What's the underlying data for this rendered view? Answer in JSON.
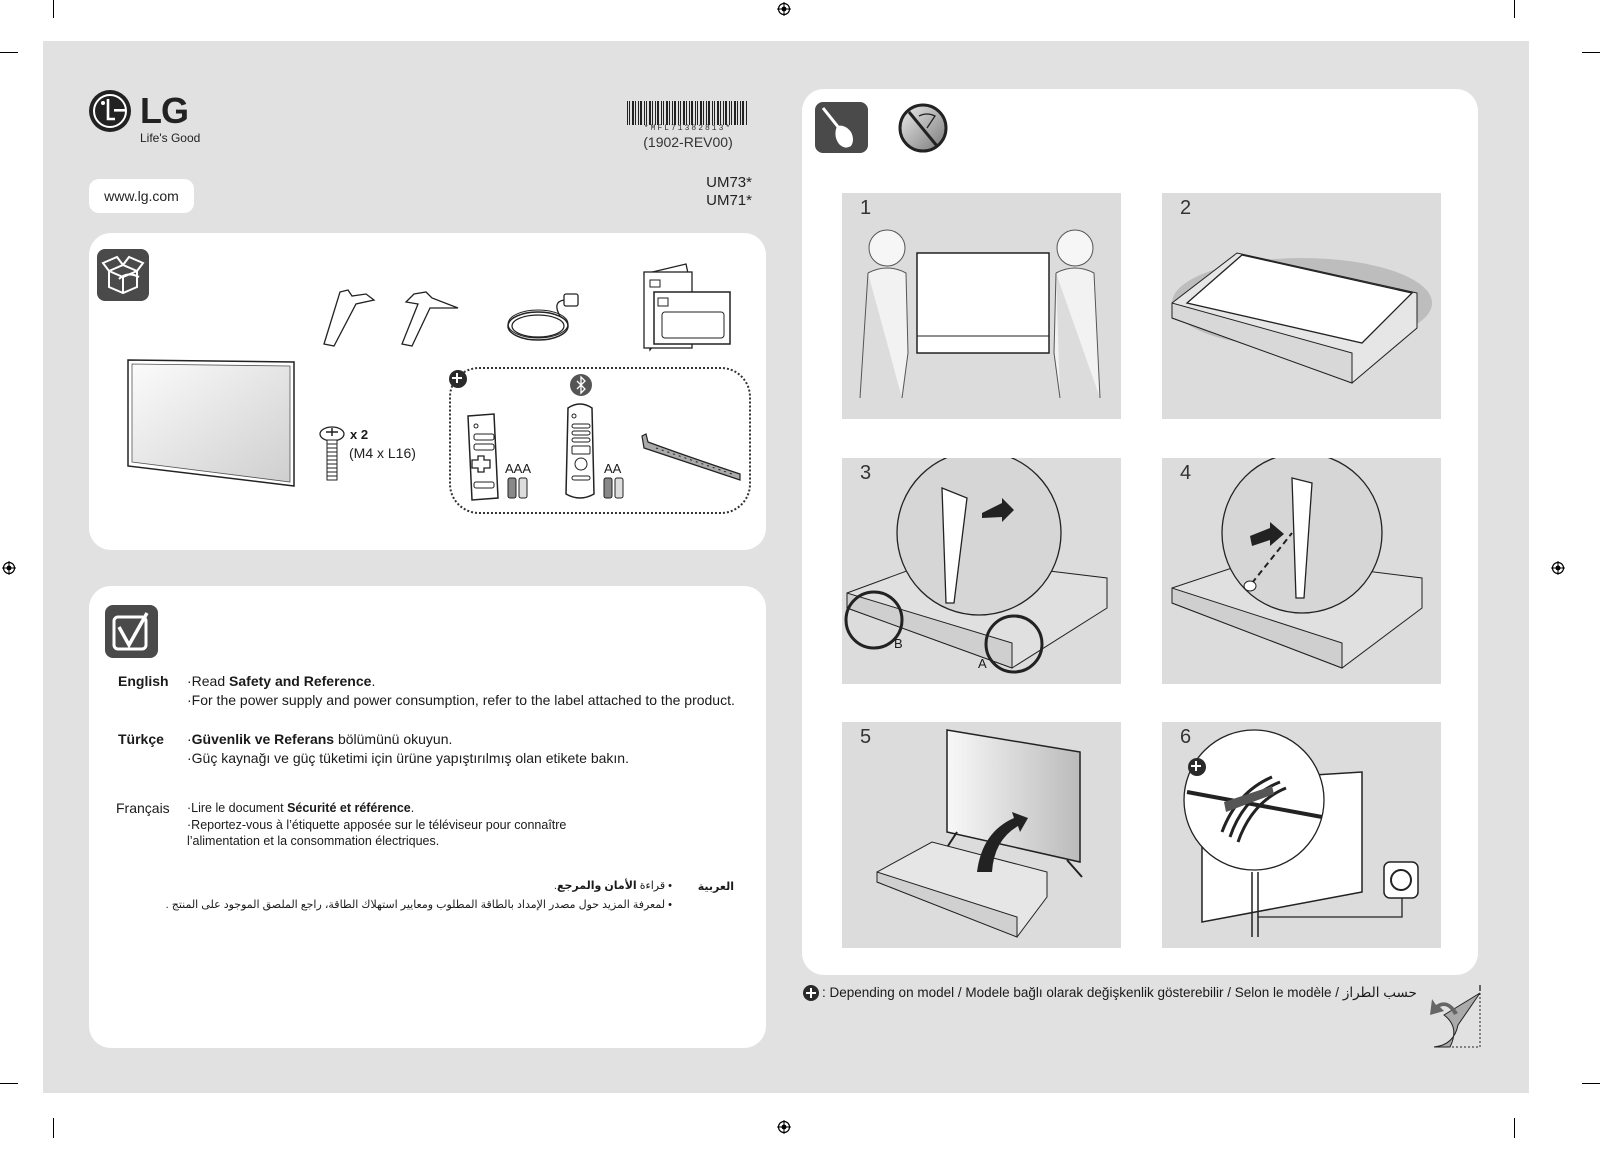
{
  "header": {
    "brand": "LG",
    "tagline": "Life's Good",
    "website": "www.lg.com",
    "barcode_text": "*MFL71382813*",
    "revision": "(1902-REV00)",
    "models": [
      "UM73*",
      "UM71*"
    ]
  },
  "box_contents": {
    "icon": "open-box-icon",
    "items": [
      "tv-panel",
      "stand-legs",
      "power-cord",
      "manuals"
    ],
    "screw_qty": "x 2",
    "screw_spec": "(M4 x L16)",
    "optional_badge_icon": "plus-circle-icon",
    "bluetooth_icon": "bluetooth-icon",
    "battery_labels": [
      "AAA",
      "AA"
    ]
  },
  "notes": {
    "icon": "checklist-icon",
    "languages": [
      {
        "name": "English",
        "lines": [
          {
            "pre": "·Read ",
            "bold": "Safety and Reference",
            "post": "."
          },
          {
            "pre": "·For the power supply and power consumption,  refer to the label attached to the product.",
            "bold": "",
            "post": ""
          }
        ]
      },
      {
        "name": "Türkçe",
        "lines": [
          {
            "pre": "·",
            "bold": "Güvenlik ve Referans",
            "post": " bölümünü okuyun."
          },
          {
            "pre": "·Güç kaynağı ve güç tüketimi için ürüne yapıştırılmış  olan etikete bakın.",
            "bold": "",
            "post": ""
          }
        ]
      },
      {
        "name": "Français",
        "lines": [
          {
            "pre": "·Lire le document ",
            "bold": "Sécurité et référence",
            "post": "."
          },
          {
            "pre": "·Reportez-vous à l’étiquette apposée sur le téléviseur pour connaître",
            "bold": "",
            "post": ""
          },
          {
            "pre": " l’alimentation et la consommation électriques.",
            "bold": "",
            "post": ""
          }
        ]
      },
      {
        "name": "العربية",
        "lines": [
          {
            "pre": "• قراءة ",
            "bold": "الأمان والمرجع",
            "post": "."
          },
          {
            "pre": "• لمعرفة المزيد حول مصدر الإمداد بالطاقة المطلوب ومعايير استهلاك الطاقة، راجع الملصق الموجود على المنتج .",
            "bold": "",
            "post": ""
          }
        ]
      }
    ]
  },
  "assembly": {
    "tool_icon": "screwdriver-icon",
    "warning_icon": "no-sharp-object-icon",
    "steps": [
      {
        "number": "1",
        "labels": []
      },
      {
        "number": "2",
        "labels": []
      },
      {
        "number": "3",
        "labels": [
          "B",
          "A"
        ]
      },
      {
        "number": "4",
        "labels": []
      },
      {
        "number": "5",
        "labels": []
      },
      {
        "number": "6",
        "labels": []
      }
    ]
  },
  "footnote": {
    "icon": "plus-circle-icon",
    "text": ": Depending on model / Modele bağlı olarak değişkenlik gösterebilir / Selon le modèle / حسب الطراز"
  },
  "page_turn_icon": "page-turn-icon"
}
